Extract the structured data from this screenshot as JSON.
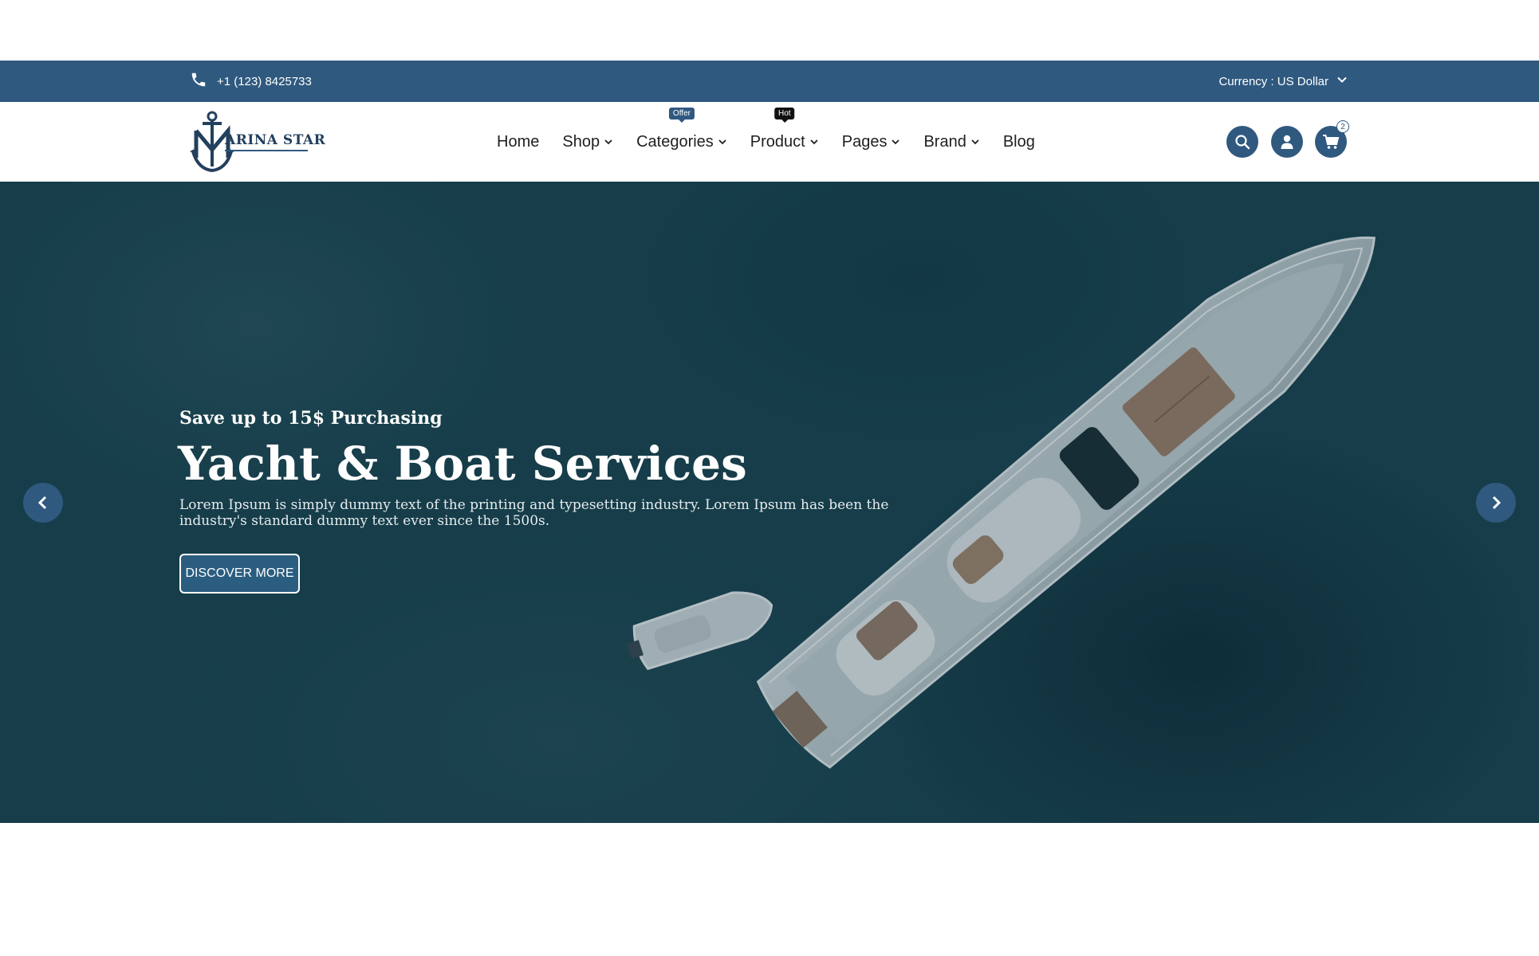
{
  "topbar": {
    "phone": "+1 (123) 8425733",
    "currency_label": "Currency : US Dollar"
  },
  "header": {
    "logo_text": "ARINA STAR",
    "nav": [
      {
        "label": "Home",
        "dropdown": false,
        "badge": ""
      },
      {
        "label": "Shop",
        "dropdown": true,
        "badge": ""
      },
      {
        "label": "Categories",
        "dropdown": true,
        "badge": "Offer"
      },
      {
        "label": "Product",
        "dropdown": true,
        "badge": "Hot"
      },
      {
        "label": "Pages",
        "dropdown": true,
        "badge": ""
      },
      {
        "label": "Brand",
        "dropdown": true,
        "badge": ""
      },
      {
        "label": "Blog",
        "dropdown": false,
        "badge": ""
      }
    ],
    "cart_count": "2"
  },
  "hero": {
    "subtitle": "Save up to 15$ Purchasing",
    "title": "Yacht & Boat Services",
    "description": "Lorem Ipsum is simply dummy text of the printing and typesetting industry. Lorem Ipsum has been the industry's standard dummy text ever since the 1500s.",
    "button_label": "DISCOVER MORE"
  },
  "colors": {
    "primary": "#2f597f",
    "hero_bg": "#1b4451",
    "hot_badge": "#111111"
  },
  "icons": [
    "phone-icon",
    "chevron-down-icon",
    "anchor-icon",
    "search-icon",
    "user-icon",
    "cart-icon",
    "chevron-left-icon",
    "chevron-right-icon"
  ]
}
